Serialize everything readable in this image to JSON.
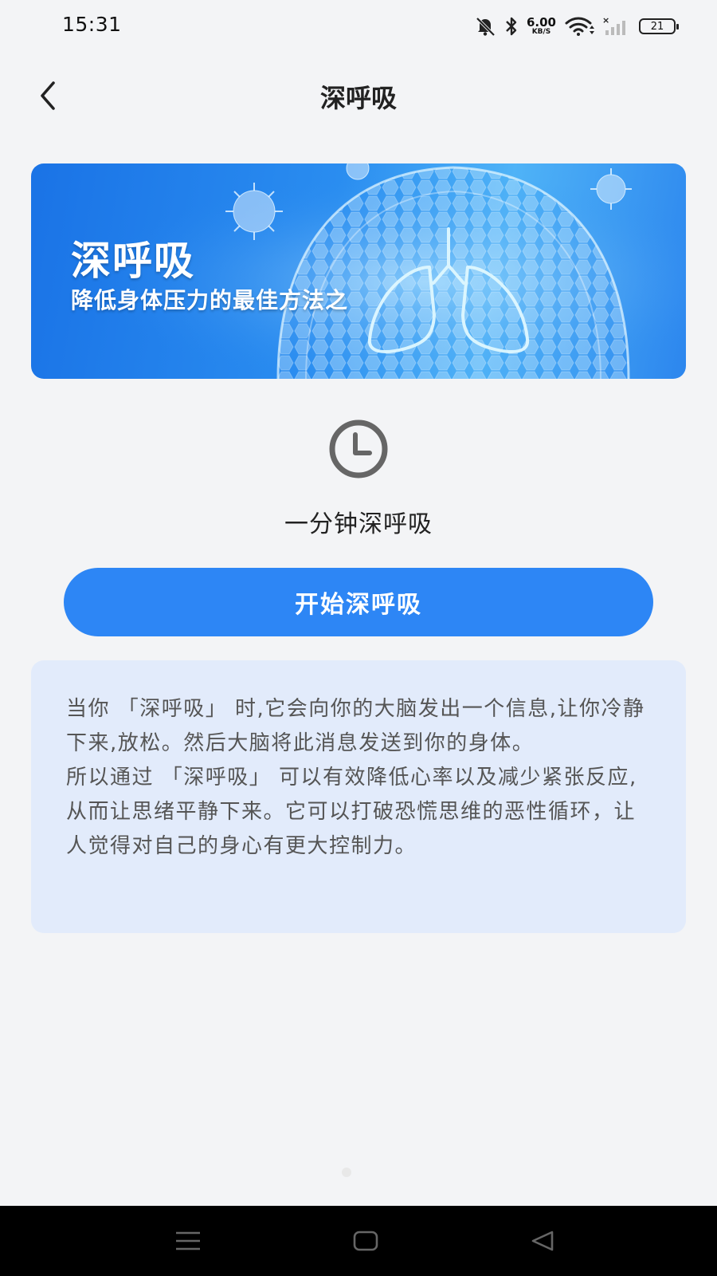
{
  "status_bar": {
    "time": "15:31",
    "net_speed_value": "6.00",
    "net_speed_unit": "KB/S",
    "battery_level": "21",
    "icons": [
      "mute-icon",
      "bluetooth-icon",
      "wifi-icon",
      "signal-icon",
      "battery-icon"
    ]
  },
  "header": {
    "title": "深呼吸",
    "back_icon": "chevron-left-icon"
  },
  "banner": {
    "title": "深呼吸",
    "subtitle": "降低身体压力的最佳方法之"
  },
  "main": {
    "clock_icon": "clock-icon",
    "duration_label": "一分钟深呼吸",
    "start_button_label": "开始深呼吸"
  },
  "description": {
    "paragraph1": "当你 「深呼吸」 时,它会向你的大脑发出一个信息,让你冷静下来,放松。然后大脑将此消息发送到你的身体。",
    "paragraph2": "所以通过 「深呼吸」 可以有效降低心率以及减少紧张反应,从而让思绪平静下来。它可以打破恐慌思维的恶性循环，让人觉得对自己的身心有更大控制力。"
  },
  "nav_bar": {
    "icons": [
      "menu-icon",
      "home-icon",
      "back-triangle-icon"
    ]
  },
  "colors": {
    "primary": "#2d86f5",
    "card_bg": "#e2ebfb",
    "page_bg": "#f3f4f6"
  }
}
